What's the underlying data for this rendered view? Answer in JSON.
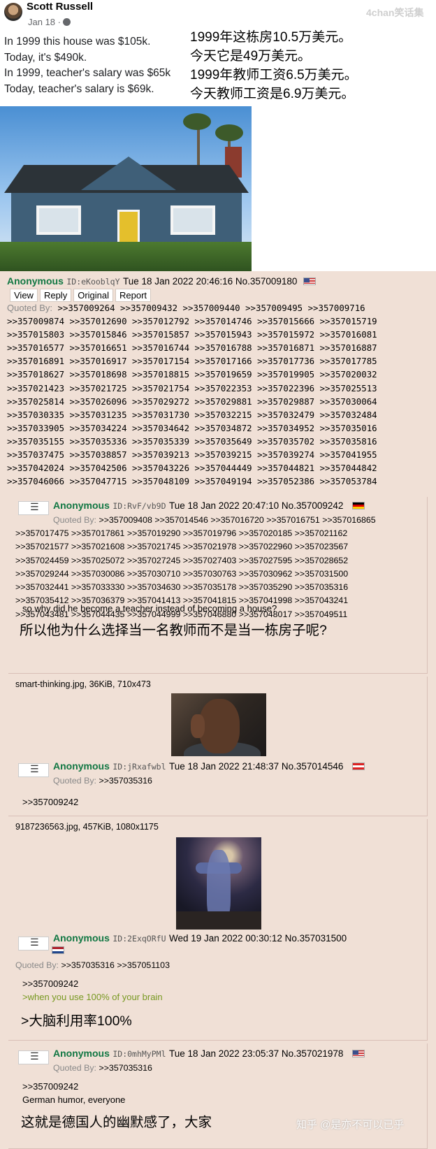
{
  "meme": {
    "author": "Scott Russell",
    "date": "Jan 18 ·",
    "lines_en": [
      "In 1999 this house was $105k.",
      "Today, it's $490k.",
      "In 1999, teacher's salary was $65k",
      "Today, teacher's salary is $69k."
    ],
    "lines_cn": [
      "1999年这栋房10.5万美元。",
      "今天它是49万美元。",
      "1999年教师工资6.5万美元。",
      "今天教师工资是6.9万美元。"
    ],
    "watermark": "4chan笑话集"
  },
  "op": {
    "name": "Anonymous",
    "id": "ID:eKooblqY",
    "datetime": "Tue 18 Jan 2022 20:46:16 No.357009180",
    "flag": "us",
    "buttons": [
      "View",
      "Reply",
      "Original",
      "Report"
    ],
    "quoted_label": "Quoted By:",
    "quoted_by": [
      ">>357009264 >>357009432 >>357009440 >>357009495 >>357009716",
      ">>357009874 >>357012690 >>357012792 >>357014746 >>357015666 >>357015719",
      ">>357015803 >>357015846 >>357015857 >>357015943 >>357015972 >>357016081",
      ">>357016577 >>357016651 >>357016744 >>357016788 >>357016871 >>357016887",
      ">>357016891 >>357016917 >>357017154 >>357017166 >>357017736 >>357017785",
      ">>357018627 >>357018698 >>357018815 >>357019659 >>357019905 >>357020032",
      ">>357021423 >>357021725 >>357021754 >>357022353 >>357022396 >>357025513",
      ">>357025814 >>357026096 >>357029272 >>357029881 >>357029887 >>357030064",
      ">>357030335 >>357031235 >>357031730 >>357032215 >>357032479 >>357032484",
      ">>357033905 >>357034224 >>357034642 >>357034872 >>357034952 >>357035016",
      ">>357035155 >>357035336 >>357035339 >>357035649 >>357035702 >>357035816",
      ">>357037475 >>357038857 >>357039213 >>357039215 >>357039274 >>357041955",
      ">>357042024 >>357042506 >>357043226 >>357044449 >>357044821 >>357044842",
      ">>357046066 >>357047715 >>357048109 >>357049194 >>357052386 >>357053784"
    ]
  },
  "replies": [
    {
      "name": "Anonymous",
      "id": "ID:RvF/vb9D",
      "datetime": "Tue 18 Jan 2022 20:47:10 No.357009242",
      "flag": "de",
      "quoted_label": "Quoted By:",
      "quoted_by": [
        ">>357009408 >>357014546 >>357016720 >>357016751 >>357016865",
        ">>357017475 >>357017861 >>357019290 >>357019796 >>357020185 >>357021162",
        ">>357021577 >>357021608 >>357021745 >>357021978 >>357022960 >>357023567",
        ">>357024459 >>357025072 >>357027245 >>357027403 >>357027595 >>357028652",
        ">>357029244 >>357030086 >>357030710 >>357030763 >>357030962 >>357031500",
        ">>357032441 >>357033330 >>357034630 >>357035178 >>357035290 >>357035316",
        ">>357035412 >>357036379 >>357041413 >>357041815 >>357041998 >>357043241",
        ">>357043481 >>357044435 >>357044999 >>357046880 >>357048017 >>357049511"
      ],
      "text": "so why did he become a teacher instead of becoming a house?",
      "translation": "所以他为什么选择当一名教师而不是当一栋房子呢?"
    },
    {
      "fileinfo": "smart-thinking.jpg, 36KiB, 710x473",
      "name": "Anonymous",
      "id": "ID:jRxafwbl",
      "datetime": "Tue 18 Jan 2022 21:48:37 No.357014546",
      "flag": "at",
      "quoted_label": "Quoted By:",
      "quoted_by": ">>357035316",
      "text": ">>357009242"
    },
    {
      "fileinfo": "9187236563.jpg, 457KiB, 1080x1175",
      "name": "Anonymous",
      "id": "ID:2ExqORfU",
      "datetime": "Wed 19 Jan 2022 00:30:12 No.357031500",
      "flag": "nl",
      "quoted_label": "Quoted By:",
      "quoted_by": ">>357035316 >>357051103",
      "text": ">>357009242",
      "greentext": ">when you use 100% of your brain",
      "translation": ">大脑利用率100%"
    },
    {
      "name": "Anonymous",
      "id": "ID:0mhMyPMl",
      "datetime": "Tue 18 Jan 2022 23:05:37 No.357021978",
      "flag": "us",
      "quoted_label": "Quoted By:",
      "quoted_by": ">>357035316",
      "text": ">>357009242",
      "text2": "German humor, everyone",
      "translation": "这就是德国人的幽默感了，大家"
    }
  ],
  "footer_watermark": "知乎 @是亦不可以已乎",
  "colors": {
    "bg": "#f0e0d6",
    "name": "#117743",
    "greentext": "#789922"
  },
  "icons": [
    "globe-icon",
    "menu-icon",
    "flag-us-icon",
    "flag-de-icon",
    "flag-at-icon",
    "flag-nl-icon"
  ]
}
